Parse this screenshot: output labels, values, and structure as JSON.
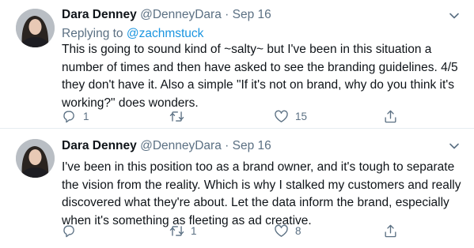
{
  "tweets": [
    {
      "author_name": "Dara Denney",
      "handle": "@DenneyDara",
      "separator": "·",
      "date": "Sep 16",
      "replying_to_prefix": "Replying to ",
      "replying_to_handle": "@zachmstuck",
      "text": "This is going to sound kind of ~salty~ but I've been in this situation a number of times and then have asked to see the branding guidelines. 4/5 they don't have it. Also a simple \"If it's not on brand, why do you think it's working?\" does wonders.",
      "reply_count": "1",
      "retweet_count": "",
      "like_count": "15"
    },
    {
      "author_name": "Dara Denney",
      "handle": "@DenneyDara",
      "separator": "·",
      "date": "Sep 16",
      "text": "I've been in this position too as a brand owner, and it's tough to separate the vision from the reality. Which is why I stalked my customers and really discovered what they're about. Let the data inform the brand, especially when it's something as fleeting as ad creative.",
      "reply_count": "",
      "retweet_count": "1",
      "like_count": "8"
    }
  ],
  "icons": {
    "reply": "reply-icon",
    "retweet": "retweet-icon",
    "like": "like-icon",
    "share": "share-icon",
    "more": "chevron-down-icon"
  },
  "colors": {
    "text": "#0f1419",
    "secondary": "#5b7083",
    "link": "#1b95e0",
    "divider": "#e6ecf0"
  }
}
